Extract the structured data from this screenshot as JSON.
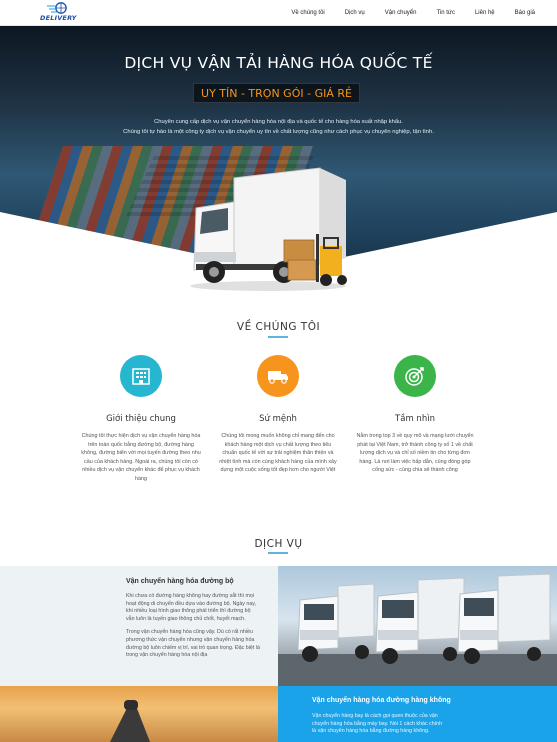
{
  "brand": {
    "logo_text": "DELIVERY"
  },
  "nav": {
    "items": [
      {
        "label": "Về chúng tôi"
      },
      {
        "label": "Dịch vụ"
      },
      {
        "label": "Vận chuyển"
      },
      {
        "label": "Tin tức"
      },
      {
        "label": "Liên hệ"
      },
      {
        "label": "Báo giá"
      }
    ]
  },
  "hero": {
    "title": "DỊCH VỤ VẬN TẢI HÀNG HÓA QUỐC TẾ",
    "badge": "UY TÍN - TRỌN GÓI - GIÁ RẺ",
    "sub_line1": "Chuyên cung cấp dịch vụ vận chuyển hàng hóa nội địa và quốc tế cho hàng hóa xuất nhập khẩu.",
    "sub_line2": "Chúng tôi tự hào là một công ty dịch vụ vận chuyển uy tín về chất lượng cũng như cách phục vụ chuyên nghiệp, tận tình."
  },
  "about": {
    "title": "VỀ CHÚNG TÔI",
    "features": [
      {
        "title": "Giới thiệu chung",
        "icon": "building-icon",
        "color": "#26b6cf",
        "text": "Chúng tôi thực hiện dịch vụ vận chuyển hàng hóa trên toàn quốc bằng đường bộ, đường hàng không, đường biển với mọi tuyến đường theo nhu cầu của khách hàng. Ngoài ra, chúng tôi còn có nhiều dịch vụ vận chuyển khác để phục vụ khách hàng"
      },
      {
        "title": "Sứ mệnh",
        "icon": "truck-icon",
        "color": "#f7941d",
        "text": "Chúng tôi mong muốn không chỉ mang đến cho khách hàng một dịch vụ chất lượng theo tiêu chuẩn quốc tế với sự trải nghiệm thân thiện và nhiệt tình mà còn cùng khách hàng của mình xây dựng một cuộc sống tốt đẹp hơn cho người Việt"
      },
      {
        "title": "Tầm nhìn",
        "icon": "target-icon",
        "color": "#3bb54a",
        "text": "Nằm trong top 3 về quy mô và mạng lưới chuyển phát tại Việt Nam, trở thành công ty số 1 về chất lượng dịch vụ và chỉ số niềm tin cho từng đơn hàng. Là nơi làm việc hấp dẫn, cùng đóng góp cống sức - cùng chia sẻ thành công"
      }
    ]
  },
  "services": {
    "title": "DỊCH VỤ",
    "road": {
      "title": "Vận chuyển hàng hóa đường bộ",
      "p1": "Khi chưa có đường hàng không hay đường sắt thì mọi hoạt động di chuyển đều dựa vào đường bộ. Ngày nay, khi nhiều loại hình giao thông phát triển thì đường bộ vẫn luôn là tuyến giao thông chủ chốt, huyết mạch.",
      "p2": "Trong vận chuyển hàng hóa cũng vậy. Dù có rất nhiều phương thức vận chuyển nhưng vận chuyển hàng hóa đường bộ luôn chiếm vị trí, vai trò quan trọng. Đặc biệt là trong vận chuyển hàng hóa nội địa"
    },
    "air": {
      "title": "Vận chuyển hàng hóa đường hàng không",
      "text": "Vận chuyển hàng bay là cách gọi quen thuộc của vận chuyển hàng hóa bằng máy bay. Nói 1 cách khác chính là vận chuyển hàng hóa bằng đường hàng không."
    }
  }
}
